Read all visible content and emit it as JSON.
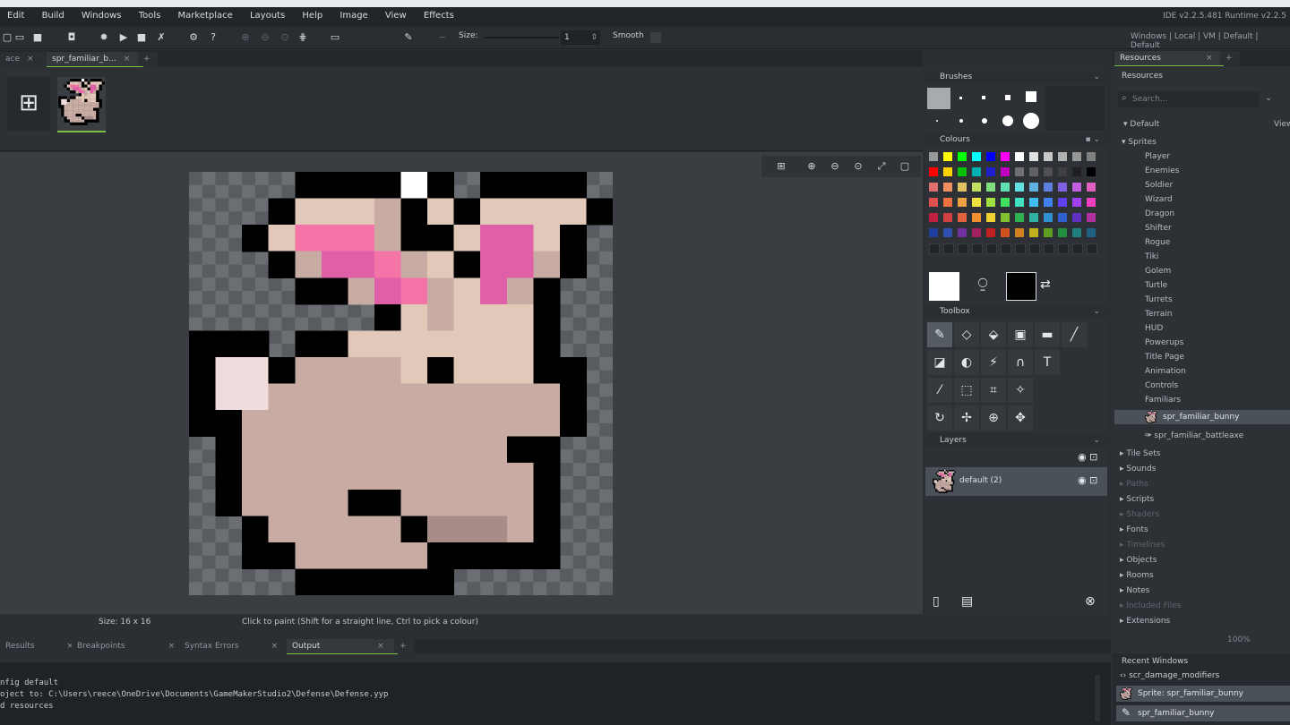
{
  "menu": [
    "Edit",
    "Build",
    "Windows",
    "Tools",
    "Marketplace",
    "Layouts",
    "Help",
    "Image",
    "View",
    "Effects"
  ],
  "ide_version": "IDE v2.2.5.481  Runtime v2.2.5",
  "toolbar": {
    "size_label": "Size:",
    "size_value": "1",
    "smooth_label": "Smooth",
    "target_path": "Windows | Local | VM | Default | Default"
  },
  "tabs": [
    {
      "label": "ace"
    },
    {
      "label": "spr_familiar_b..."
    }
  ],
  "status": {
    "size": "Size: 16 x 16",
    "hint": "Click to paint (Shift for a straight line, Ctrl to pick a colour)"
  },
  "output_tabs": [
    "Results",
    "Breakpoints",
    "Syntax Errors",
    "Output"
  ],
  "output_lines": [
    "nfig default",
    "oject to: C:\\Users\\reece\\OneDrive\\Documents\\GameMakerStudio2\\Defense\\Defense.yyp",
    "d resources"
  ],
  "panels": {
    "brushes": "Brushes",
    "colours": "Colours",
    "toolbox": "Toolbox",
    "layers": "Layers",
    "layer_name": "default (2)"
  },
  "resources": {
    "tab": "Resources",
    "title": "Resources",
    "search_placeholder": "Search...",
    "default": "Default",
    "view": "View",
    "sprites": "Sprites",
    "sprite_groups": [
      "Player",
      "Enemies",
      "Soldier",
      "Wizard",
      "Dragon",
      "Shifter",
      "Rogue",
      "Tiki",
      "Golem",
      "Turtle",
      "Turrets",
      "Terrain",
      "HUD",
      "Powerups",
      "Title Page",
      "Animation",
      "Controls",
      "Familiars"
    ],
    "selected": "spr_familiar_bunny",
    "other": "spr_familiar_battleaxe",
    "categories": [
      {
        "label": "Tile Sets",
        "dim": false
      },
      {
        "label": "Sounds",
        "dim": false
      },
      {
        "label": "Paths",
        "dim": true
      },
      {
        "label": "Scripts",
        "dim": false
      },
      {
        "label": "Shaders",
        "dim": true
      },
      {
        "label": "Fonts",
        "dim": false
      },
      {
        "label": "Timelines",
        "dim": true
      },
      {
        "label": "Objects",
        "dim": false
      },
      {
        "label": "Rooms",
        "dim": false
      },
      {
        "label": "Notes",
        "dim": false
      },
      {
        "label": "Included Files",
        "dim": true
      },
      {
        "label": "Extensions",
        "dim": false
      }
    ],
    "zoom": "100%"
  },
  "recent": {
    "title": "Recent Windows",
    "items": [
      "scr_damage_modifiers",
      "Sprite: spr_familiar_bunny",
      "spr_familiar_bunny"
    ]
  },
  "colors": {
    "accent": "#7bbf44",
    "black": "#000000",
    "white": "#ffffff"
  }
}
